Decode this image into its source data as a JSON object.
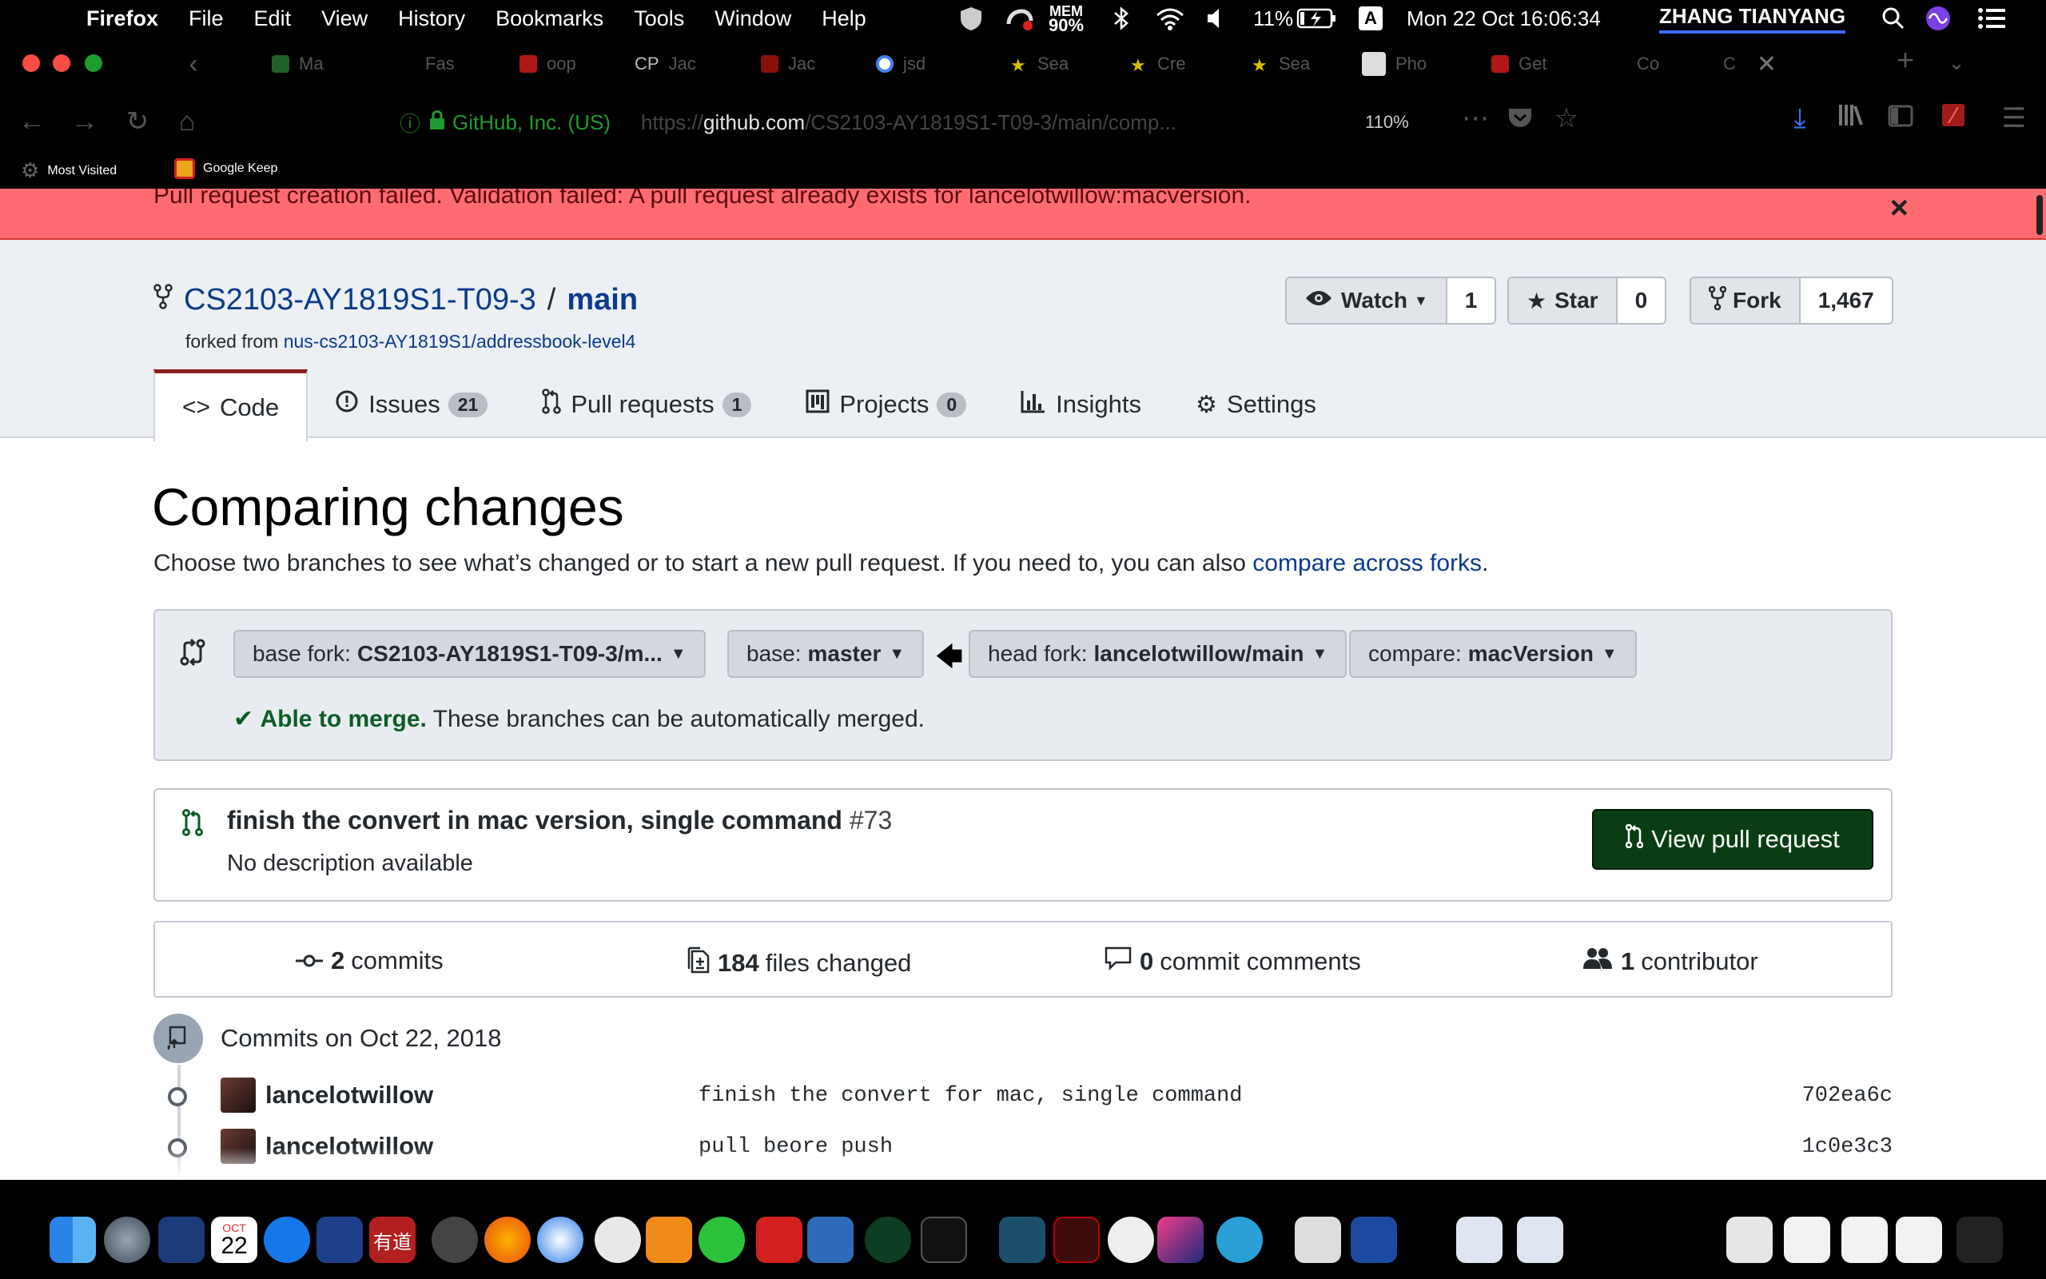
{
  "menubar": {
    "app": "Firefox",
    "items": [
      "File",
      "Edit",
      "View",
      "History",
      "Bookmarks",
      "Tools",
      "Window",
      "Help"
    ],
    "mem_label": "MEM",
    "mem_value": "90%",
    "battery": "11%",
    "input_method": "A",
    "datetime": "Mon 22 Oct  16:06:34",
    "user": "ZHANG TIANYANG"
  },
  "browser": {
    "tabs": [
      "Ma",
      "Fas",
      "oop",
      "Jac",
      "Jac",
      "jsd",
      "Sea",
      "Cre",
      "Sea",
      "Pho",
      "Get",
      "Co",
      "C"
    ],
    "tab_cp_label": "CP",
    "identity": "GitHub, Inc. (US)",
    "url_prefix": "https://",
    "url_host": "github.com",
    "url_path": "/CS2103-AY1819S1-T09-3/main/comp...",
    "zoom": "110%",
    "bookmarks": [
      "Most Visited",
      "Google Keep"
    ]
  },
  "flash": {
    "message": "Pull request creation failed. Validation failed: A pull request already exists for lancelotwillow:macversion.",
    "close": "×"
  },
  "repo": {
    "owner": "CS2103-AY1819S1-T09-3",
    "separator": "/",
    "name": "main",
    "forked_prefix": "forked from",
    "forked_from": "nus-cs2103-AY1819S1/addressbook-level4",
    "watch_label": "Watch",
    "watch_count": "1",
    "star_label": "Star",
    "star_count": "0",
    "fork_label": "Fork",
    "fork_count": "1,467",
    "tabs": [
      {
        "label": "Code",
        "counter": ""
      },
      {
        "label": "Issues",
        "counter": "21"
      },
      {
        "label": "Pull requests",
        "counter": "1"
      },
      {
        "label": "Projects",
        "counter": "0"
      },
      {
        "label": "Insights",
        "counter": ""
      },
      {
        "label": "Settings",
        "counter": ""
      }
    ]
  },
  "compare": {
    "title": "Comparing changes",
    "lead": "Choose two branches to see what’s changed or to start a new pull request. If you need to, you can also",
    "lead_link": "compare across forks",
    "lead_end": ".",
    "base_fork_prefix": "base fork:",
    "base_fork": "CS2103-AY1819S1-T09-3/m...",
    "base_prefix": "base:",
    "base": "master",
    "head_fork_prefix": "head fork:",
    "head_fork": "lancelotwillow/main",
    "compare_prefix": "compare:",
    "compare": "macVersion",
    "merge_ok": "Able to merge.",
    "merge_text": "These branches can be automatically merged."
  },
  "pull_request": {
    "title": "finish the convert in mac version, single command",
    "number": "#73",
    "description": "No description available",
    "view_button": "View pull request"
  },
  "summary": {
    "commits_count": "2",
    "commits_label": "commits",
    "files_count": "184",
    "files_label": "files changed",
    "comments_count": "0",
    "comments_label": "commit comments",
    "contributors_count": "1",
    "contributors_label": "contributor"
  },
  "commits": {
    "heading": "Commits on Oct 22, 2018",
    "rows": [
      {
        "author": "lancelotwillow",
        "message": "finish the convert for mac, single command",
        "sha": "702ea6c"
      },
      {
        "author": "lancelotwillow",
        "message": "pull beore push",
        "sha": "1c0e3c3"
      }
    ]
  },
  "dock": {
    "calendar_month": "OCT",
    "calendar_day": "22",
    "youdao": "有道"
  }
}
